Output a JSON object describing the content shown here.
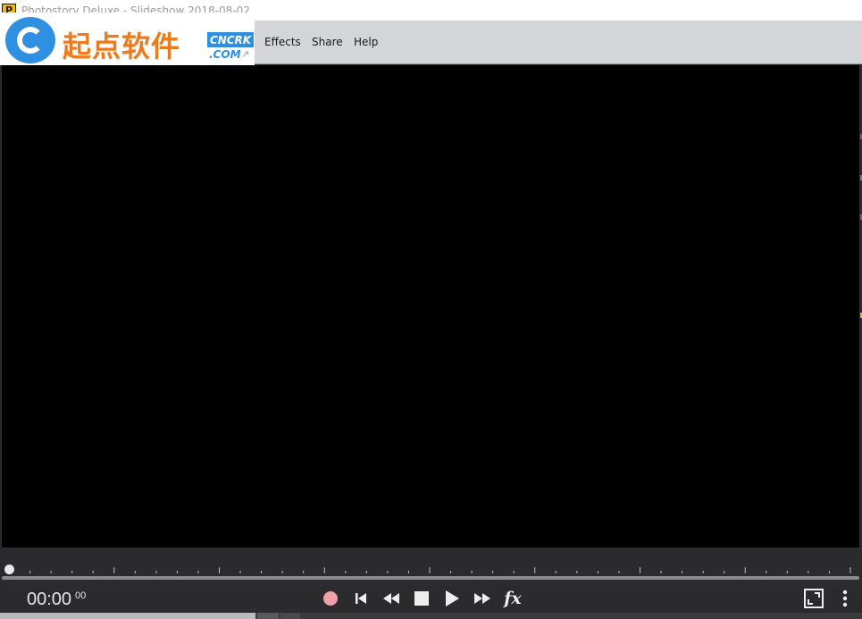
{
  "window": {
    "app_icon_letter": "P",
    "title": "Photostory Deluxe - Slideshow 2018-08-02"
  },
  "watermark": {
    "chinese_text": "起点软件",
    "badge": "CNCRK",
    "com": ".COM",
    "arrow": "↗"
  },
  "menu": {
    "items": [
      "Effects",
      "Share",
      "Help"
    ]
  },
  "transport": {
    "timecode": "00:00",
    "timecode_frames": "00",
    "fx_label": "fx",
    "icons": [
      "record-icon",
      "skip-to-start-icon",
      "rewind-icon",
      "stop-icon",
      "play-icon",
      "fast-forward-icon",
      "fx-icon",
      "fullscreen-icon",
      "more-options-icon"
    ],
    "record_color": "#f0a0a8",
    "icon_color": "#eeeeee"
  },
  "timeline": {
    "playhead_position": 0
  },
  "colors": {
    "preview": "#000000",
    "panel": "#2b2b2e",
    "menubar": "#d4d5d8"
  }
}
